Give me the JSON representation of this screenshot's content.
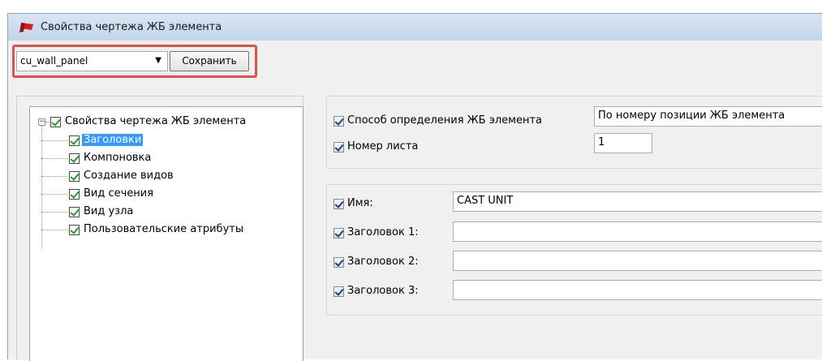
{
  "window": {
    "title": "Свойства чертежа ЖБ элемента",
    "icon": "red-flag-app-icon"
  },
  "toolbar": {
    "preset_value": "cu_wall_panel",
    "save_label": "Сохранить"
  },
  "tree": {
    "root": {
      "label": "Свойства чертежа ЖБ элемента",
      "checked": true,
      "expanded": true
    },
    "items": [
      {
        "label": "Заголовки",
        "checked": true,
        "selected": true
      },
      {
        "label": "Компоновка",
        "checked": true
      },
      {
        "label": "Создание видов",
        "checked": true
      },
      {
        "label": "Вид сечения",
        "checked": true
      },
      {
        "label": "Вид узла",
        "checked": true
      },
      {
        "label": "Пользовательские атрибуты",
        "checked": true
      }
    ]
  },
  "definition": {
    "method_label": "Способ определения ЖБ элемента",
    "method_value": "По номеру позиции ЖБ элемента",
    "sheet_label": "Номер листа",
    "sheet_value": "1"
  },
  "titles": {
    "name_label": "Имя:",
    "name_value": "CAST UNIT",
    "title1_label": "Заголовок 1:",
    "title1_value": "",
    "title2_label": "Заголовок 2:",
    "title2_value": "",
    "title3_label": "Заголовок 3:",
    "title3_value": ""
  },
  "colors": {
    "highlight_border": "#d9534f",
    "selection": "#3399ff",
    "check_green": "#1e9e1e"
  }
}
